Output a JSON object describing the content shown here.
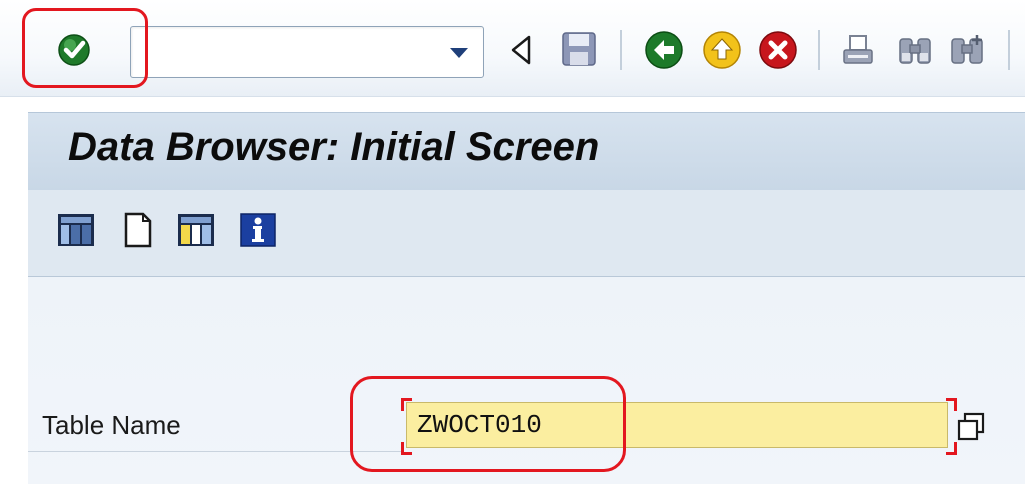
{
  "toolbar": {
    "enter_icon": "green-check-icon",
    "command_field_value": "",
    "command_dropdown_icon": "triangle-down-icon",
    "back_nav_icon": "triangle-left-icon",
    "save_icon": "floppy-disk-icon",
    "back_icon": "green-back-arrow-icon",
    "exit_icon": "yellow-up-arrow-icon",
    "cancel_icon": "red-x-icon",
    "print_icon": "printer-icon",
    "find_icon": "binoculars-icon",
    "find_next_icon": "binoculars-plus-icon"
  },
  "header": {
    "title": "Data Browser: Initial Screen"
  },
  "app_toolbar": {
    "icons": [
      "table-contents-icon",
      "new-entries-icon",
      "table-fields-icon",
      "info-icon"
    ]
  },
  "form": {
    "table_name_label": "Table Name",
    "table_name_value": "ZWOCT010",
    "value_help_icon": "value-help-icon"
  },
  "colors": {
    "highlight_red": "#e3171f",
    "input_yellow": "#fbeea0",
    "title_bar_blue": "#cbd9e8"
  }
}
